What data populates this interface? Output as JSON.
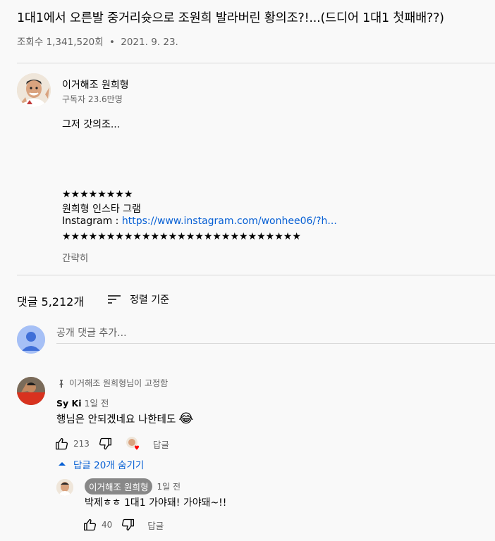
{
  "video": {
    "title": "1대1에서 오른발 중거리슛으로 조원희 발라버린 황의조?!...(드디어 1대1 첫패배??)",
    "views": "조회수 1,341,520회",
    "separator": "•",
    "date": "2021. 9. 23."
  },
  "channel": {
    "name": "이거해조 원희형",
    "subscribers": "구독자 23.6만명"
  },
  "description": {
    "line1": "그저 갓의조...",
    "stars_short": "★★★★★★★★",
    "insta_label": "원희형 인스타 그램",
    "insta_prefix": "Instagram : ",
    "insta_link": "https://www.instagram.com/wonhee06/?h...",
    "stars_long": "★★★★★★★★★★★★★★★★★★★★★★★★★★★",
    "show_less": "간략히"
  },
  "comments_header": {
    "count": "댓글 5,212개",
    "sort_label": "정렬 기준"
  },
  "add_comment": {
    "placeholder": "공개 댓글 추가..."
  },
  "pinned_comment": {
    "pinned_label": "이거해조 원희형님이 고정함",
    "author": "Sy Ki",
    "time": "1일 전",
    "text": "행님은 안되겠네요 나한테도",
    "emoji": "😂",
    "likes": "213",
    "reply_label": "답글",
    "hide_replies": "답글 20개 숨기기"
  },
  "reply_comment": {
    "author": "이거해조 원희형",
    "time": "1일 전",
    "text": "박제ㅎㅎ 1대1 가야돼! 가야돼~!!",
    "likes": "40",
    "reply_label": "답글"
  },
  "colors": {
    "link": "#065fd4",
    "secondary_text": "#606060",
    "heart": "#ff0000"
  }
}
